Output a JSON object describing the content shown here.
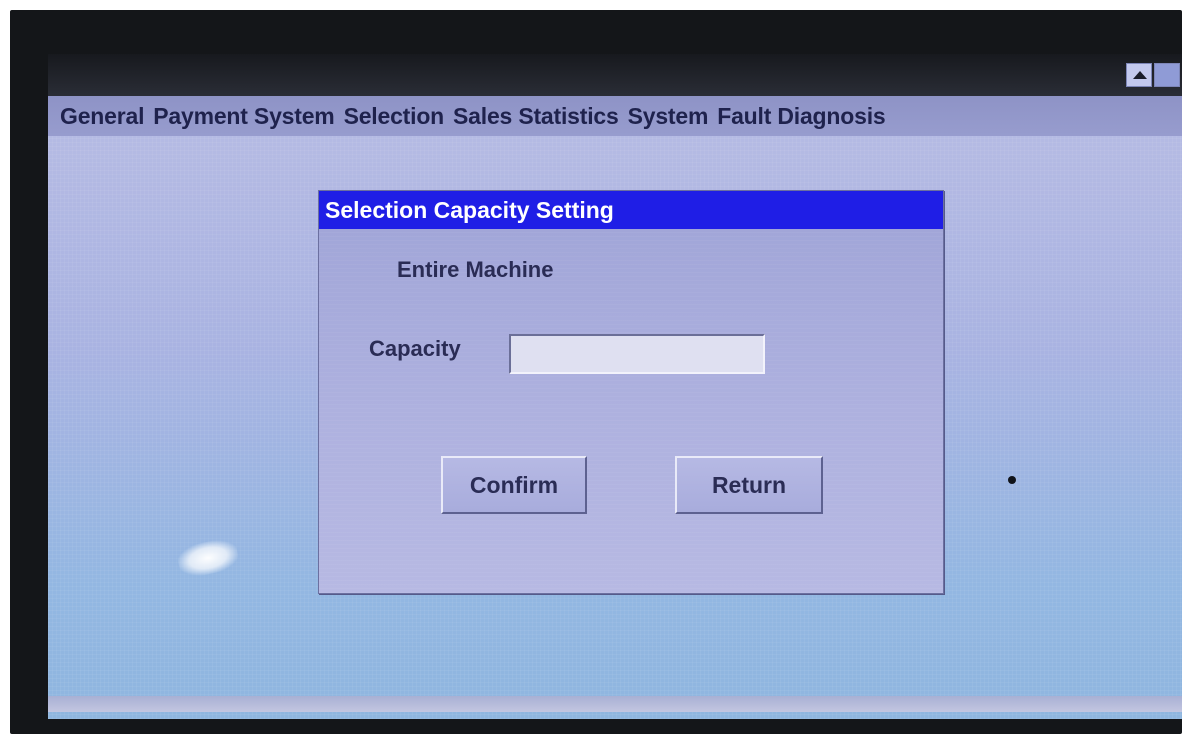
{
  "menubar": {
    "items": [
      {
        "label": "General"
      },
      {
        "label": "Payment System"
      },
      {
        "label": "Selection"
      },
      {
        "label": "Sales Statistics"
      },
      {
        "label": "System"
      },
      {
        "label": "Fault Diagnosis"
      }
    ]
  },
  "window_controls": {
    "up_icon": "triangle-up-icon",
    "square_icon": "square-icon"
  },
  "dialog": {
    "title": "Selection Capacity Setting",
    "subtitle": "Entire Machine",
    "capacity_label": "Capacity",
    "capacity_value": "",
    "confirm_label": "Confirm",
    "return_label": "Return"
  },
  "colors": {
    "dialog_title_bg": "#1f1ee6",
    "screen_bg": "#a9b3e2",
    "menubar_bg": "#979cce"
  }
}
